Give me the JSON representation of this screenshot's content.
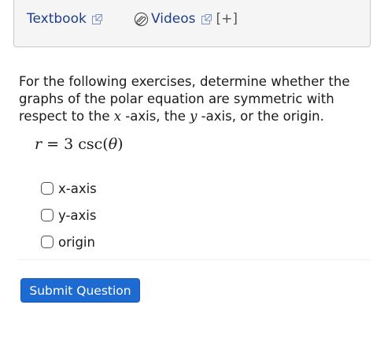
{
  "resources": {
    "textbook_label": "Textbook",
    "videos_label": "Videos",
    "plus_label": "[+]"
  },
  "question": {
    "part1": "For the following exercises, determine whether the graphs of the polar equation are symmetric with respect to the ",
    "x_var": "x",
    "part2": " -axis, the ",
    "y_var": "y",
    "part3": " -axis, or the origin."
  },
  "equation": {
    "lhs": "r",
    "equals": " = ",
    "rhs_coef": "3",
    "rhs_func": " csc(",
    "rhs_var": "θ",
    "rhs_close": ")"
  },
  "options": [
    {
      "label": "x-axis",
      "checked": false
    },
    {
      "label": "y-axis",
      "checked": false
    },
    {
      "label": "origin",
      "checked": false
    }
  ],
  "submit_label": "Submit Question",
  "colors": {
    "link": "#1f3f8a",
    "button": "#1d6ad1",
    "panel_bg": "#f5f5f5"
  },
  "icons": [
    "external-link-icon",
    "paperclip-icon"
  ]
}
